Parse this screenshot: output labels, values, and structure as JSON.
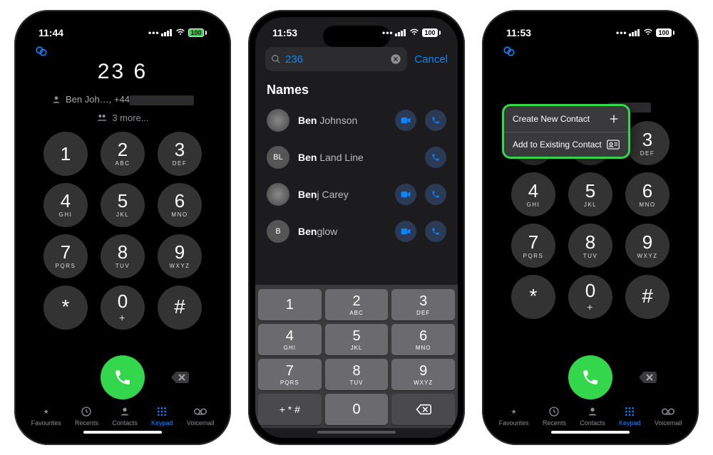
{
  "status": {
    "time1": "11:44",
    "time2": "11:53",
    "time3": "11:53",
    "battery_pct": "100"
  },
  "dialer": {
    "number": "23 6",
    "match_name": "Ben Joh…,",
    "match_number_prefix": "+44",
    "more_label": "3 more...",
    "keys": [
      {
        "n": "1",
        "l": ""
      },
      {
        "n": "2",
        "l": "ABC"
      },
      {
        "n": "3",
        "l": "DEF"
      },
      {
        "n": "4",
        "l": "GHI"
      },
      {
        "n": "5",
        "l": "JKL"
      },
      {
        "n": "6",
        "l": "MNO"
      },
      {
        "n": "7",
        "l": "PQRS"
      },
      {
        "n": "8",
        "l": "TUV"
      },
      {
        "n": "9",
        "l": "WXYZ"
      },
      {
        "n": "*",
        "l": ""
      },
      {
        "n": "0",
        "l": "+"
      },
      {
        "n": "#",
        "l": ""
      }
    ]
  },
  "tabs": {
    "favourites": "Favourites",
    "recents": "Recents",
    "contacts": "Contacts",
    "keypad": "Keypad",
    "voicemail": "Voicemail"
  },
  "search": {
    "query": "236",
    "cancel": "Cancel",
    "section": "Names",
    "results": [
      {
        "hl": "Ben",
        "rest": " Johnson",
        "avatar": "",
        "video": true
      },
      {
        "hl": "Ben",
        "rest": " Land Line",
        "avatar": "BL",
        "video": false
      },
      {
        "hl": "Ben",
        "rest": "j Carey",
        "avatar": "",
        "video": true
      },
      {
        "hl": "Ben",
        "rest": "glow",
        "avatar": "B",
        "video": true
      }
    ]
  },
  "keyboard": {
    "keys": [
      {
        "n": "1",
        "l": ""
      },
      {
        "n": "2",
        "l": "ABC"
      },
      {
        "n": "3",
        "l": "DEF"
      },
      {
        "n": "4",
        "l": "GHI"
      },
      {
        "n": "5",
        "l": "JKL"
      },
      {
        "n": "6",
        "l": "MNO"
      },
      {
        "n": "7",
        "l": "PQRS"
      },
      {
        "n": "8",
        "l": "TUV"
      },
      {
        "n": "9",
        "l": "WXYZ"
      }
    ],
    "sym": "+ * #",
    "zero": "0"
  },
  "menu": {
    "create": "Create New Contact",
    "add": "Add to Existing Contact"
  }
}
